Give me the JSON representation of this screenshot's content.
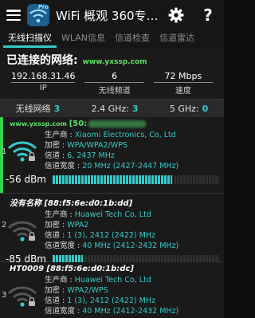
{
  "app": {
    "title": "WiFi 概观 360专…",
    "icon_badge": "Pro"
  },
  "tabs": [
    {
      "label": "无线扫描仪",
      "active": true
    },
    {
      "label": "WLAN信息",
      "active": false
    },
    {
      "label": "信道检查",
      "active": false
    },
    {
      "label": "信道雷达",
      "active": false
    }
  ],
  "connected": {
    "title": "已连接的网络:",
    "site": "www.yxssp.com",
    "fields": [
      {
        "value": "192.168.31.46",
        "label": "IP"
      },
      {
        "value": "6",
        "label": "无线频道"
      },
      {
        "value": "72 Mbps",
        "label": "速度"
      }
    ]
  },
  "summary": {
    "total_label": "无线网络",
    "total": "3",
    "g24_label": "2.4 GHz:",
    "g24": "3",
    "g5_label": "5 GHz:",
    "g5": "0"
  },
  "labels": {
    "vendor": "生产商 :",
    "enc": "加密 :",
    "channel": "信道 :",
    "bw": "信道宽度 :"
  },
  "networks": [
    {
      "index": "1",
      "ssid": "www.yxssp.com",
      "mac": "[50:",
      "vendor": "Xiaomi Electronics, Co, Ltd",
      "encryption": "WPA/WPA2/WPS",
      "channel": "6, 2437 MHz",
      "bandwidth": "20 MHz (2427-2447 MHz)",
      "dbm": "-56 dBm",
      "signal": 0.72,
      "connected": true
    },
    {
      "index": "2",
      "ssid": "没有名称",
      "mac": "[88:f5:6e:d0:1b:dd]",
      "vendor": "Huawei Tech Co, Ltd",
      "encryption": "WPA2",
      "channel": "1 (3), 2412 (2422) MHz",
      "bandwidth": "40 MHz (2412-2432 MHz)",
      "dbm": "-85 dBm",
      "signal": 0.18,
      "connected": false
    },
    {
      "index": "3",
      "ssid": "HT0009",
      "mac": "[88:f5:6e:d0:1b:dc]",
      "vendor": "Huawei Tech Co, Ltd",
      "encryption": "WPA2/WPS",
      "channel": "1 (3), 2412 (2422) MHz",
      "bandwidth": "40 MHz (2412-2432 MHz)",
      "dbm": "",
      "signal": 0,
      "connected": false
    }
  ],
  "colors": {
    "accent": "#37c8c8",
    "green": "#39d353",
    "background": "#1a1a1a"
  }
}
